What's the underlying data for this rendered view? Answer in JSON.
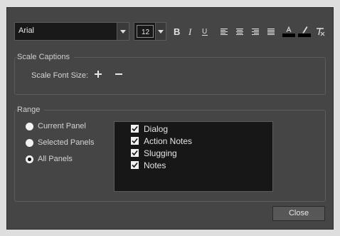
{
  "toolbar": {
    "font_family_value": "Arial",
    "font_size_value": "12",
    "icons": [
      "bold-icon",
      "italic-icon",
      "underline-icon",
      "align-left-icon",
      "align-center-icon",
      "align-right-icon",
      "justify-icon",
      "text-color-icon",
      "highlight-color-icon",
      "clear-format-icon"
    ],
    "colors": {
      "text_swatch": "#000000",
      "highlight_swatch": "#000000"
    }
  },
  "scale_captions": {
    "title": "Scale Captions",
    "font_size_label": "Scale Font Size:",
    "increase_label": "+",
    "decrease_label": "−"
  },
  "range": {
    "title": "Range",
    "options": [
      {
        "label": "Current Panel",
        "selected": false
      },
      {
        "label": "Selected Panels",
        "selected": false
      },
      {
        "label": "All Panels",
        "selected": true
      }
    ],
    "captions": [
      {
        "label": "Dialog",
        "checked": true
      },
      {
        "label": "Action Notes",
        "checked": true
      },
      {
        "label": "Slugging",
        "checked": true
      },
      {
        "label": "Notes",
        "checked": true
      }
    ]
  },
  "footer": {
    "close_label": "Close"
  }
}
